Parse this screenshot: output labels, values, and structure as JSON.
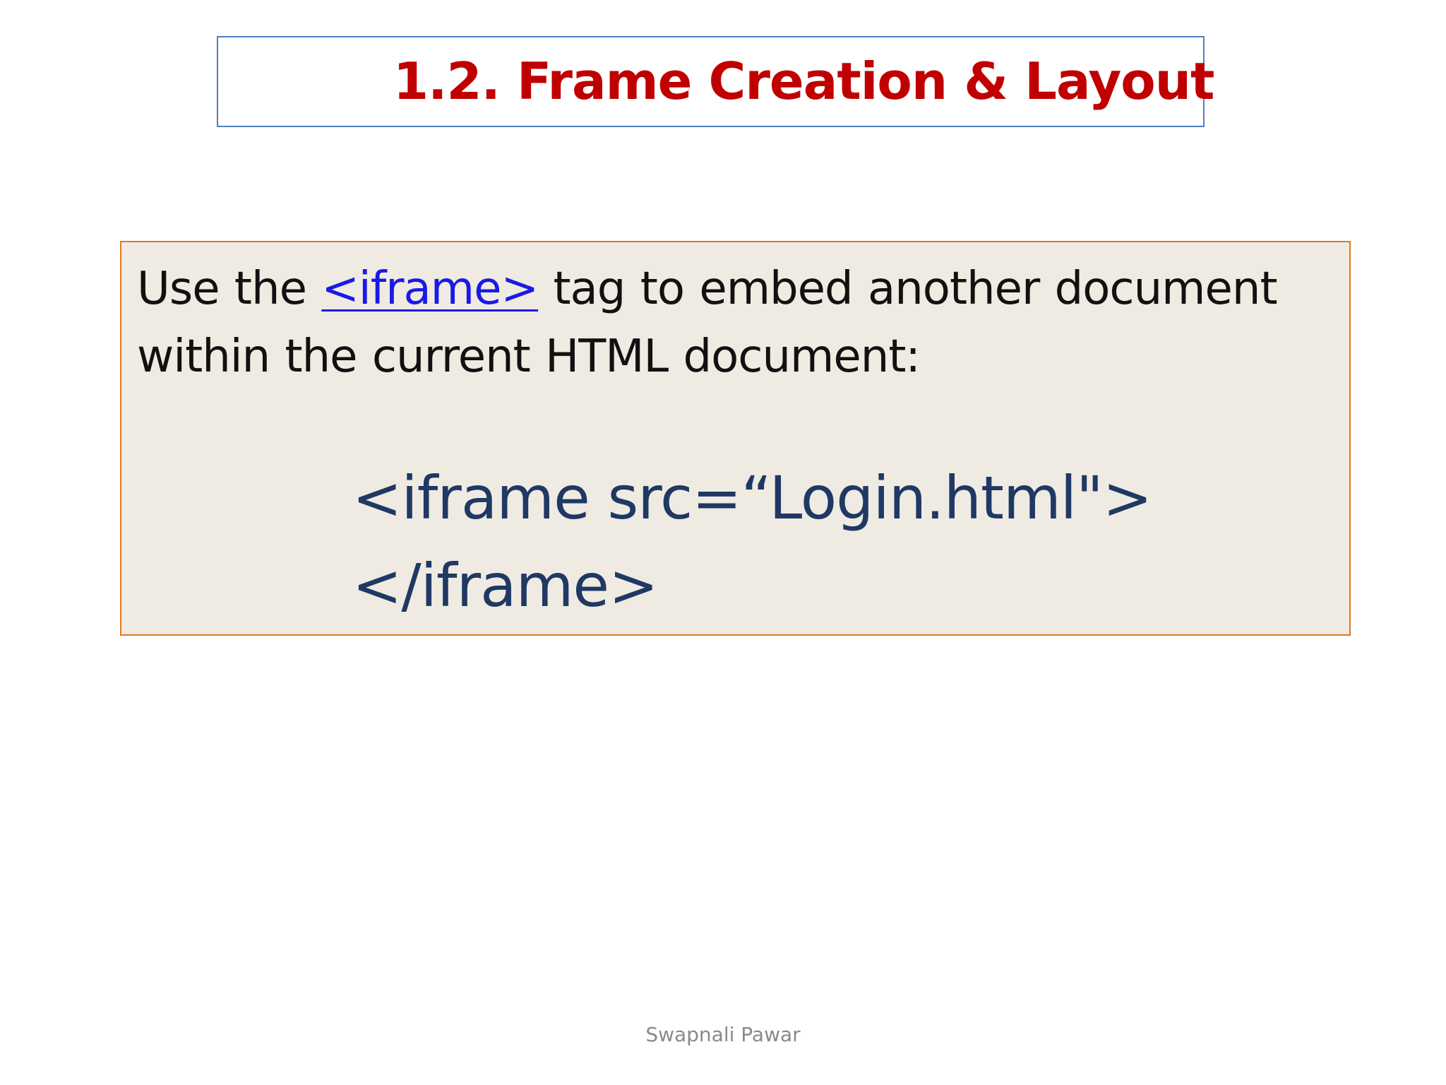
{
  "slide": {
    "title": "1.2. Frame Creation & Layout",
    "intro": {
      "prefix": "Use the ",
      "link_text": "<iframe>",
      "suffix": " tag to embed another document",
      "line2": "within the current HTML document:"
    },
    "code": {
      "line1": "<iframe src=“Login.html\">",
      "line2": "</iframe>"
    },
    "footer": "Swapnali Pawar"
  },
  "colors": {
    "title": "#c00000",
    "title_border": "#4f7fc4",
    "content_border": "#e07a1f",
    "content_background": "#efebe2",
    "link": "#1a1ae6",
    "code": "#1f3864",
    "footer": "#8a8a8a"
  }
}
